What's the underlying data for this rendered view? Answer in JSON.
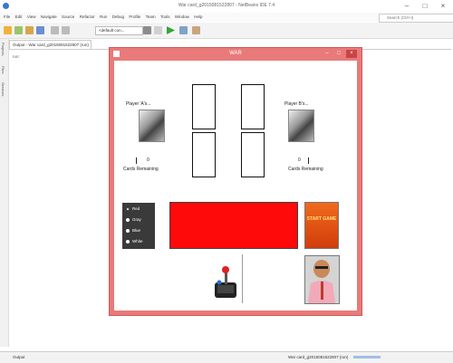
{
  "ide": {
    "title": "War card_g2015081522807 - NetBeans IDE 7.4",
    "menu": [
      "File",
      "Edit",
      "View",
      "Navigate",
      "Source",
      "Refactor",
      "Run",
      "Debug",
      "Profile",
      "Team",
      "Tools",
      "Window",
      "Help"
    ],
    "search_placeholder": "Search (Ctrl+I)",
    "config_select": "<default con...",
    "output_tab": "Output - War card_g2015081522807 (run)",
    "output_text": "run:",
    "left_tabs": [
      "Projects",
      "Files",
      "Services"
    ],
    "status_left": "Output",
    "status_right": "War card_g2015081522807 (run)"
  },
  "app": {
    "title": "WAR",
    "player_left": {
      "label": "Player 'A's...",
      "count": "0",
      "remaining_label": "Cards Remaining"
    },
    "player_right": {
      "label": "Player B's...",
      "count": "0",
      "remaining_label": "Cards Remaining"
    },
    "colors": {
      "options": [
        "Red",
        "Gray",
        "Blue",
        "White"
      ],
      "selected": "Red"
    },
    "start_label": "START GAME",
    "accent": "#ff0a0a",
    "window_color": "#e97a7a"
  }
}
